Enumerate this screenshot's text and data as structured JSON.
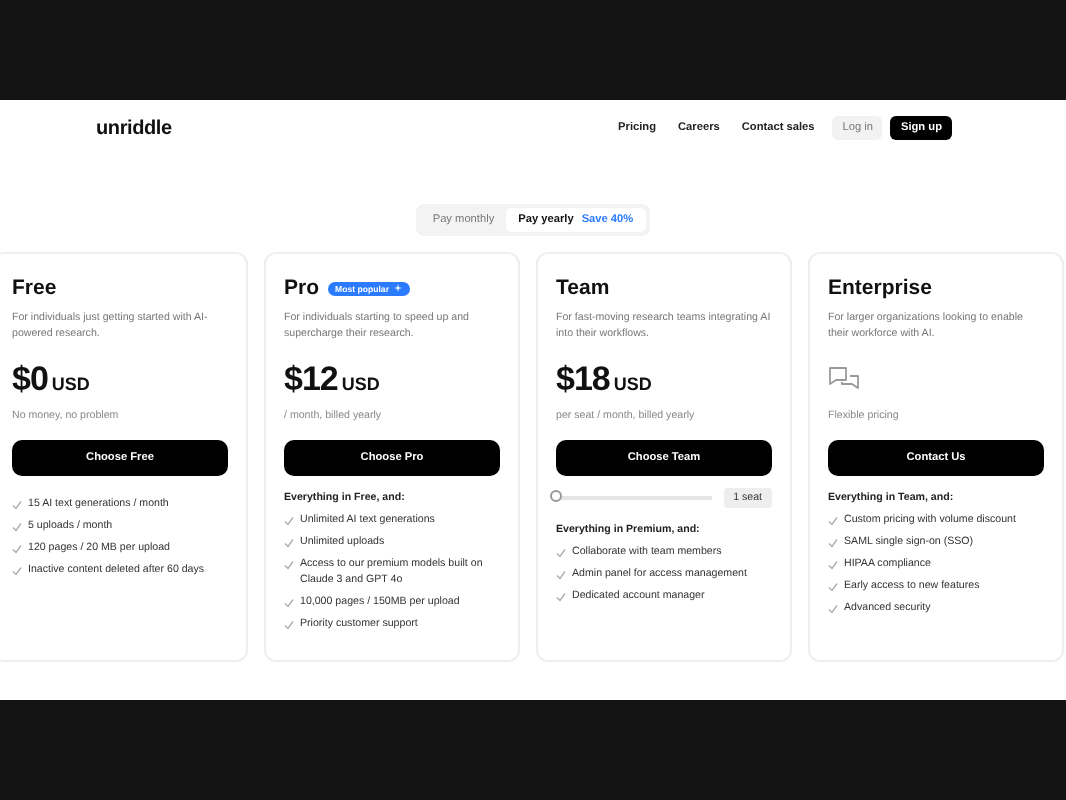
{
  "nav": {
    "logo": "unriddle",
    "links": [
      "Pricing",
      "Careers",
      "Contact sales"
    ],
    "login": "Log in",
    "signup": "Sign up"
  },
  "billing_toggle": [
    {
      "label": "Pay monthly",
      "selected": false
    },
    {
      "label": "Pay yearly",
      "selected": true,
      "badge": "Save 40%"
    }
  ],
  "plans": [
    {
      "kind": "price",
      "name": "Free",
      "description": "For individuals just getting started with AI-powered research.",
      "price": "$0",
      "currency": "USD",
      "price_note": "No money, no problem",
      "button": "Choose Free",
      "features": [
        "15 AI text generations / month",
        "5 uploads / month",
        "120 pages / 20 MB per upload",
        "Inactive content deleted after 60 days"
      ]
    },
    {
      "kind": "price",
      "name": "Pro",
      "badge": "Most popular",
      "description": "For individuals starting to speed up and supercharge their research.",
      "price": "$12",
      "currency": "USD",
      "price_note": "/ month, billed yearly",
      "button": "Choose Pro",
      "features_heading": "Everything in Free, and:",
      "features": [
        "Unlimited AI text generations",
        "Unlimited uploads",
        "Access to our premium models built on Claude 3 and GPT 4o",
        "10,000 pages / 150MB per upload",
        "Priority customer support"
      ]
    },
    {
      "kind": "price",
      "name": "Team",
      "description": "For fast-moving research teams integrating AI into their workflows.",
      "price": "$18",
      "currency": "USD",
      "price_note": "per seat / month, billed yearly",
      "button": "Choose Team",
      "seats": {
        "level": 0,
        "label": "1 seat"
      },
      "features_heading": "Everything in Premium, and:",
      "features": [
        "Collaborate with team members",
        "Admin panel for access management",
        "Dedicated account manager"
      ]
    },
    {
      "kind": "contact",
      "name": "Enterprise",
      "description": "For larger organizations looking to enable their workforce with AI.",
      "price_note": "Flexible pricing",
      "button": "Contact Us",
      "features_heading": "Everything in Team, and:",
      "features": [
        "Custom pricing with volume discount",
        "SAML single sign-on (SSO)",
        "HIPAA compliance",
        "Early access to new features",
        "Advanced security"
      ]
    }
  ]
}
